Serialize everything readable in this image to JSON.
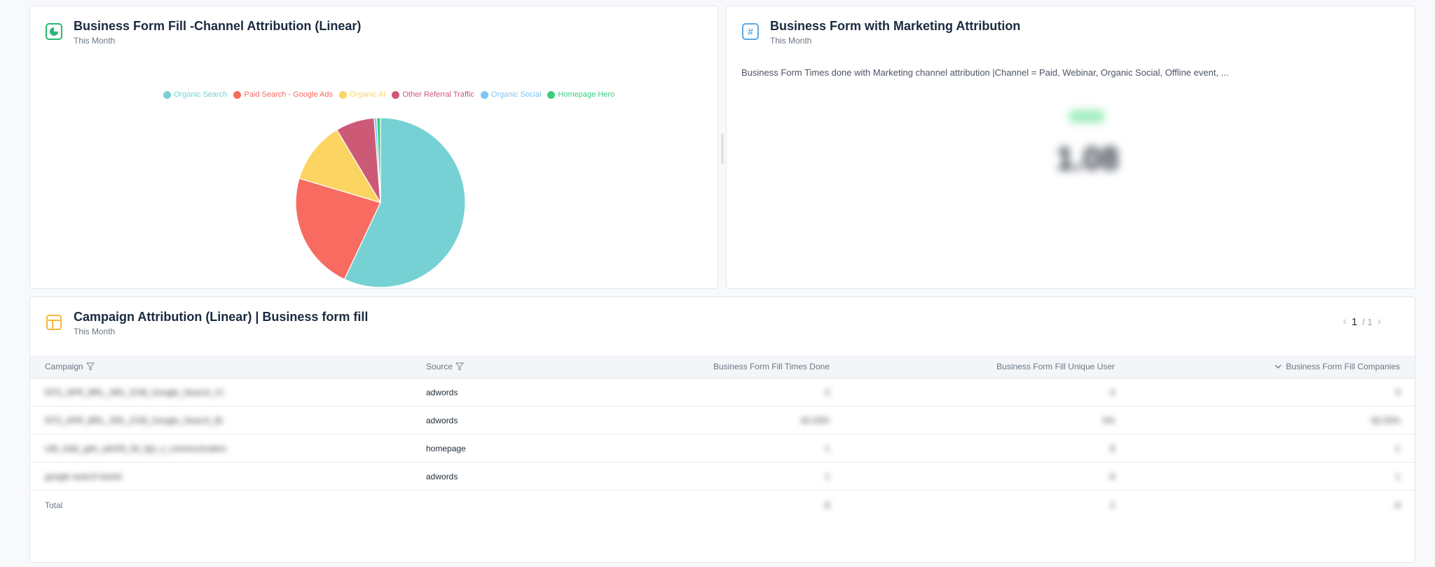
{
  "pie_card": {
    "title": "Business Form Fill -Channel Attribution (Linear)",
    "subtitle": "This Month",
    "icon": "pie-chart-icon",
    "accent": "#2bb673"
  },
  "chart_data": {
    "type": "pie",
    "title": "",
    "legend_position": "top",
    "categories": [
      "Organic Search",
      "Paid Search - Google Ads",
      "Organic AI",
      "Other Referral Traffic",
      "Organic Social",
      "Homepage Hero"
    ],
    "values": [
      57.0,
      22.6,
      11.8,
      7.4,
      0.5,
      0.7
    ],
    "colors": [
      "#76d1d4",
      "#f76b61",
      "#fcd462",
      "#cc5a77",
      "#7ec4f4",
      "#3ccb7f"
    ],
    "start_angle_deg": 0
  },
  "kpi_card": {
    "title": "Business Form with Marketing Attribution",
    "subtitle": "This Month",
    "icon": "hash-icon",
    "description": "Business Form Times done with Marketing channel attribution |Channel = Paid, Webinar, Organic Social, Offline event, ...",
    "value": "1.08"
  },
  "table_card": {
    "title": "Campaign Attribution (Linear) | Business form fill",
    "subtitle": "This Month",
    "icon": "table-icon",
    "pager": {
      "current": "1",
      "total": "/ 1"
    },
    "columns": [
      "Campaign",
      "Source",
      "Business Form Fill Times Done",
      "Business Form Fill Unique User",
      "Business Form Fill Companies"
    ],
    "rows": [
      [
        "NTS_APR_BRL_SRL_EXB_Google_Search_CI",
        "adwords",
        "2",
        "4",
        "3"
      ],
      [
        "NTS_APR_BRL_SRL_EXB_Google_Search_Br",
        "adwords",
        "82.03%",
        "5%",
        "82.03%"
      ],
      [
        "cdh_hide_gdn_ad105_hb_fgn_x_communication",
        "homepage",
        "1",
        "8",
        "1"
      ],
      [
        "google search brand",
        "adwords",
        "1",
        "8",
        "1"
      ]
    ],
    "total": {
      "label": "Total",
      "values": [
        "8",
        "2",
        "8"
      ]
    }
  }
}
